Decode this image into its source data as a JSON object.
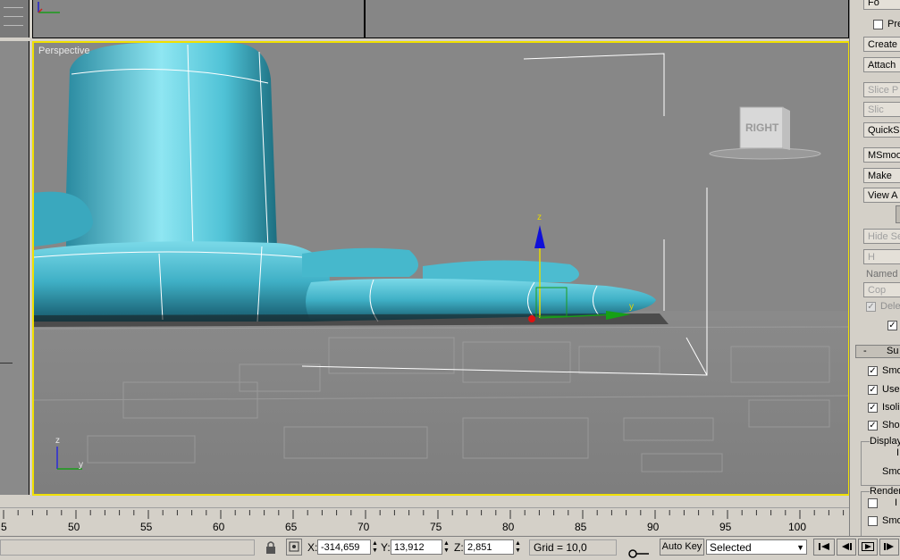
{
  "viewport": {
    "label": "Perspective",
    "viewcube_label": "RIGHT",
    "gizmo_axis_z": "z",
    "gizmo_axis_y": "y",
    "corner_axis_z": "z",
    "corner_axis_y": "y"
  },
  "command_panel": {
    "items": [
      {
        "kind": "button",
        "label": "Fo",
        "disabled": false
      },
      {
        "kind": "check",
        "label": "Pre",
        "checked": false
      },
      {
        "kind": "button",
        "label": "Create",
        "disabled": false
      },
      {
        "kind": "button",
        "label": "Attach",
        "disabled": false
      },
      {
        "kind": "button",
        "label": "Slice P",
        "disabled": true
      },
      {
        "kind": "button",
        "label": "Slic",
        "disabled": true
      },
      {
        "kind": "button",
        "label": "QuickS",
        "disabled": false
      },
      {
        "kind": "button",
        "label": "MSmoo",
        "disabled": false
      },
      {
        "kind": "button",
        "label": "Make",
        "disabled": false
      },
      {
        "kind": "button",
        "label": "View A",
        "disabled": false
      },
      {
        "kind": "button",
        "label": "Hide Sel",
        "disabled": true
      },
      {
        "kind": "button",
        "label": "H",
        "disabled": true
      },
      {
        "kind": "text",
        "label": "Named S"
      },
      {
        "kind": "button",
        "label": "Cop",
        "disabled": true
      },
      {
        "kind": "check",
        "label": "Dele",
        "checked": true,
        "disabled": true
      }
    ],
    "rollout_title": "Su",
    "rollout_toggle": "-",
    "options": [
      {
        "label": "Smo",
        "checked": true
      },
      {
        "label": "Use",
        "checked": true
      },
      {
        "label": "Isoli",
        "checked": true
      },
      {
        "label": "Sho",
        "checked": true
      }
    ],
    "group_display": "Display",
    "group_display_row1": "I",
    "group_display_row2": "Smo",
    "group_render": "Render",
    "group_render_row1": "I",
    "group_render_row2": "Smo"
  },
  "timeline": {
    "labels": [
      "5",
      "50",
      "55",
      "60",
      "65",
      "70",
      "75",
      "80",
      "85",
      "90",
      "95",
      "100"
    ]
  },
  "status_bar": {
    "x_label": "X:",
    "x_value": "-314,659",
    "y_label": "Y:",
    "y_value": "13,912",
    "z_label": "Z:",
    "z_value": "2,851",
    "grid": "Grid = 10,0",
    "auto_key": "Auto Key",
    "selection_mode": "Selected"
  },
  "colors": {
    "active_viewport_border": "#f0e000",
    "mesh": "#3fb6cc",
    "viewport_bg": "#878787"
  }
}
